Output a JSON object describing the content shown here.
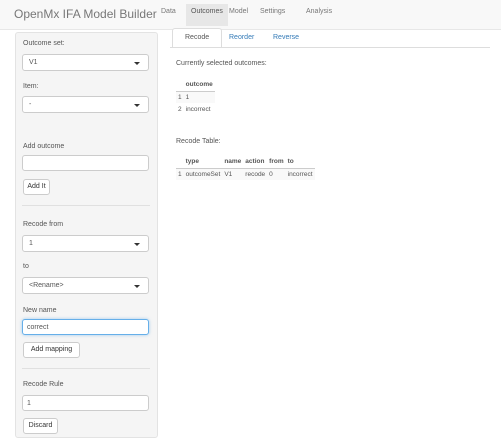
{
  "navbar": {
    "brand": "OpenMx IFA Model Builder",
    "tabs": [
      {
        "label": "Data"
      },
      {
        "label": "Outcomes"
      },
      {
        "label": "Model"
      },
      {
        "label": "Settings"
      },
      {
        "label": "Analysis"
      }
    ],
    "active_tab": "Outcomes"
  },
  "sidebar": {
    "outcome_set_label": "Outcome set:",
    "outcome_set_value": "V1",
    "item_label": "Item:",
    "item_value": "-",
    "add_outcome_label": "Add outcome",
    "add_outcome_value": "",
    "add_it_button": "Add It",
    "recode_from_label": "Recode from",
    "recode_from_value": "1",
    "to_label": "to",
    "to_value": "<Rename>",
    "new_name_label": "New name",
    "new_name_value": "correct",
    "add_mapping_button": "Add mapping",
    "recode_rule_label": "Recode Rule",
    "recode_rule_value": "1",
    "discard_button": "Discard"
  },
  "main": {
    "subtabs": [
      {
        "label": "Recode"
      },
      {
        "label": "Reorder"
      },
      {
        "label": "Reverse"
      }
    ],
    "active_subtab": "Recode",
    "selected_outcomes_label": "Currently selected outcomes:",
    "outcomes_table": {
      "header": "outcome",
      "rows": [
        {
          "n": "1",
          "value": "1"
        },
        {
          "n": "2",
          "value": "incorrect"
        }
      ]
    },
    "recode_table_label": "Recode Table:",
    "recode_table": {
      "headers": [
        "type",
        "name",
        "action",
        "from",
        "to"
      ],
      "rows": [
        {
          "n": "1",
          "type": "outcomeSet",
          "name": "V1",
          "action": "recode",
          "from": "0",
          "to": "incorrect"
        }
      ]
    }
  }
}
